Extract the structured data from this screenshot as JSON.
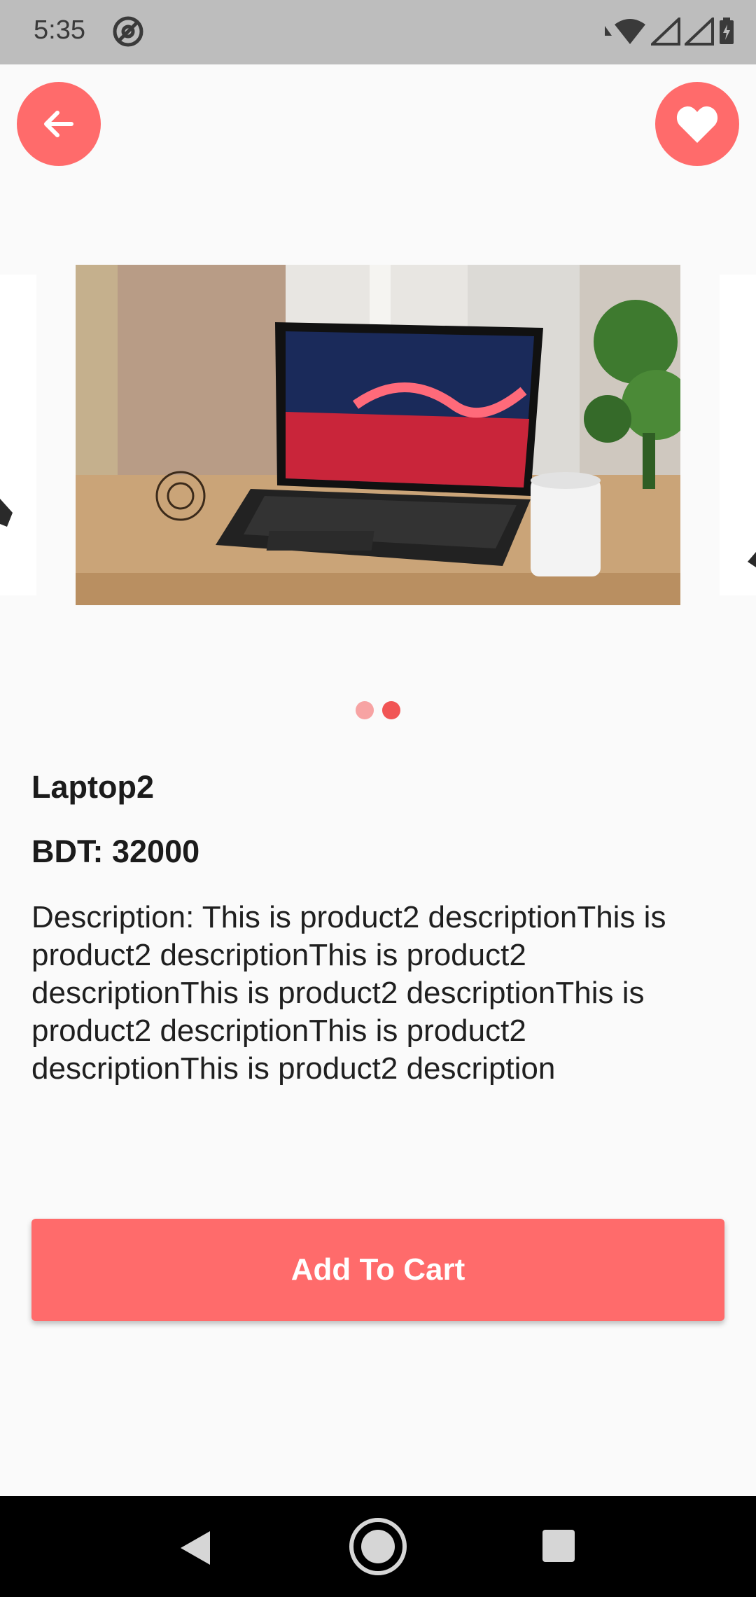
{
  "status_bar": {
    "time": "5:35",
    "icons": [
      "at-sign-icon",
      "wifi-icon",
      "signal-icon",
      "signal-icon",
      "battery-icon"
    ]
  },
  "header": {
    "back_icon": "arrow-left-icon",
    "favorite_icon": "heart-icon"
  },
  "carousel": {
    "slides": [
      "laptop-left-partial",
      "laptop-main",
      "laptop-right-partial"
    ],
    "active_index": 1,
    "dot_count": 2
  },
  "product": {
    "title": "Laptop2",
    "price": "BDT: 32000",
    "description": "Description: This is product2 descriptionThis is product2 descriptionThis is product2 descriptionThis is product2 descriptionThis is product2 descriptionThis is product2 descriptionThis is product2 description"
  },
  "actions": {
    "add_to_cart_label": "Add To Cart"
  },
  "colors": {
    "accent": "#ff6b6b",
    "dot_active": "#f15555",
    "dot_inactive": "#f7a3a3",
    "status_bar": "#bdbdbd",
    "background": "#fafafa"
  },
  "nav_bar": {
    "icons": [
      "nav-back-icon",
      "nav-home-icon",
      "nav-recents-icon"
    ]
  }
}
